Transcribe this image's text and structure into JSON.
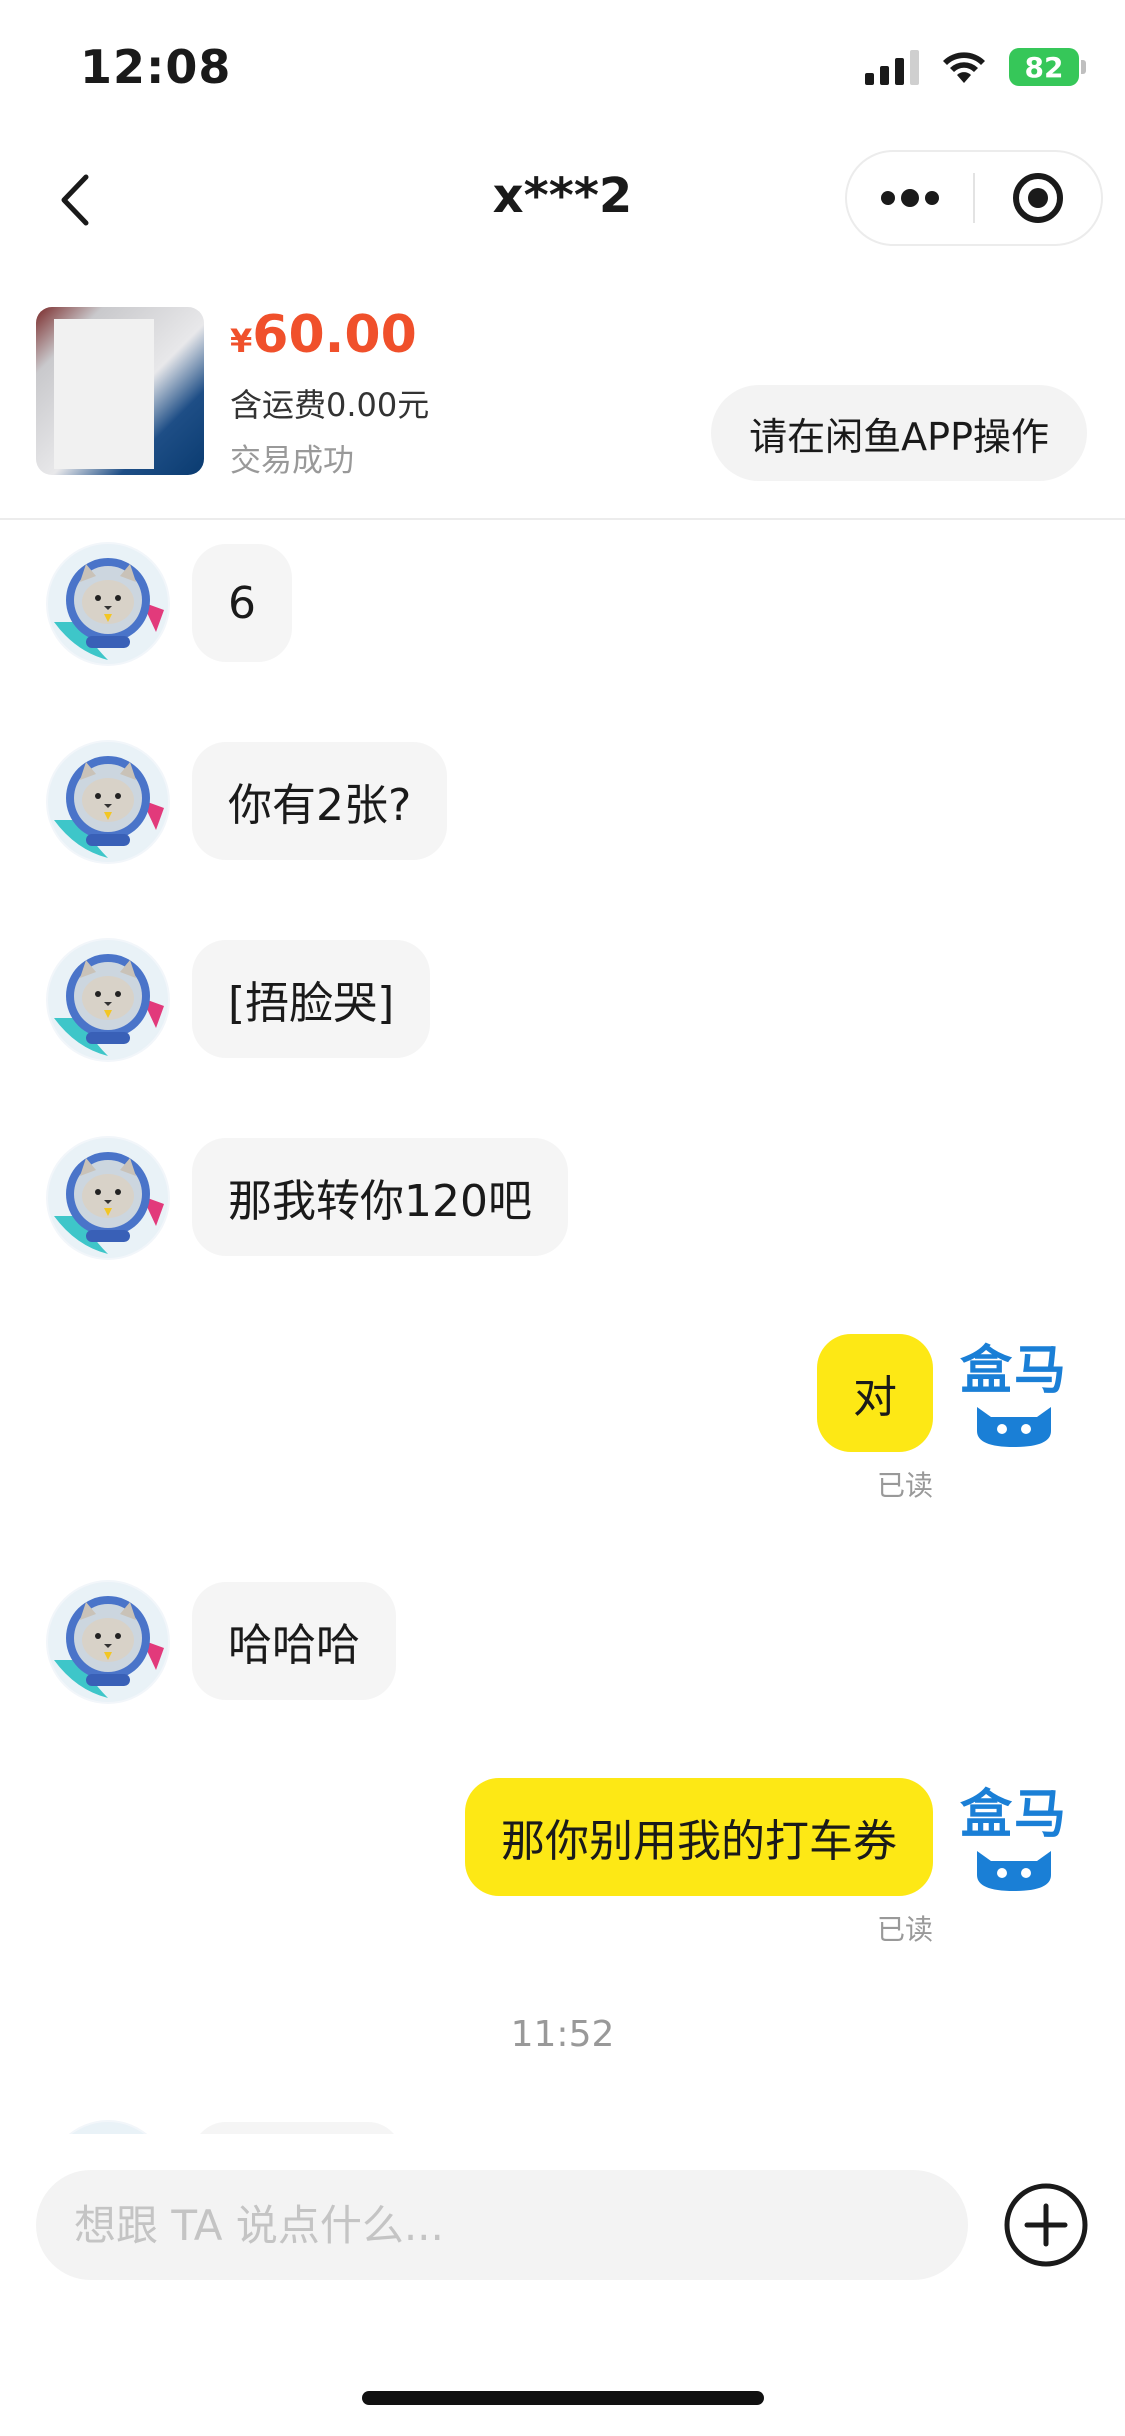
{
  "status_bar": {
    "time": "12:08",
    "battery": "82",
    "icons": [
      "signal-icon",
      "wifi-icon",
      "battery-icon"
    ]
  },
  "header": {
    "title": "x***2",
    "icons": [
      "back-chevron-icon",
      "more-dots-icon",
      "target-icon"
    ]
  },
  "order": {
    "currency": "¥",
    "price": "60.00",
    "shipping": "含运费0.00元",
    "status": "交易成功",
    "action_label": "请在闲鱼APP操作"
  },
  "messages": [
    {
      "side": "left",
      "text": "6"
    },
    {
      "side": "left",
      "text": "你有2张?"
    },
    {
      "side": "left",
      "text": "[捂脸哭]"
    },
    {
      "side": "left",
      "text": "那我转你120吧"
    },
    {
      "side": "right",
      "text": "对",
      "status": "已读"
    },
    {
      "side": "left",
      "text": "哈哈哈"
    },
    {
      "side": "right",
      "text": "那你别用我的打车券",
      "status": "已读"
    }
  ],
  "timestamp": "11:52",
  "brand_avatar_text": "盒马",
  "input": {
    "placeholder": "想跟 TA 说点什么..."
  },
  "colors": {
    "price": "#f0502b",
    "own_bubble": "#fde815",
    "other_bubble": "#f5f5f5",
    "battery": "#36c759",
    "brand_blue": "#1a7fd6"
  }
}
